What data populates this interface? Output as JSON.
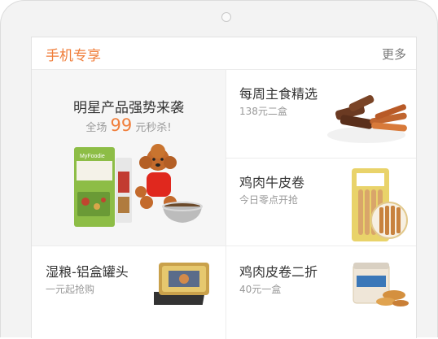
{
  "section": {
    "title": "手机专享",
    "more_label": "更多"
  },
  "hero": {
    "title": "明星产品强势来袭",
    "sub_prefix": "全场",
    "price": "99",
    "sub_suffix": "元秒杀!",
    "bag_brand": "MyFoodie"
  },
  "cells": [
    {
      "title": "每周主食精选",
      "subtitle": "138元二盒"
    },
    {
      "title": "鸡肉牛皮卷",
      "subtitle": "今日零点开抢"
    },
    {
      "title": "湿粮-铝盒罐头",
      "subtitle": "一元起抢购"
    },
    {
      "title": "鸡肉皮卷二折",
      "subtitle": "40元一盒"
    }
  ],
  "colors": {
    "accent": "#f07e3b",
    "text": "#333333",
    "muted": "#999999"
  }
}
